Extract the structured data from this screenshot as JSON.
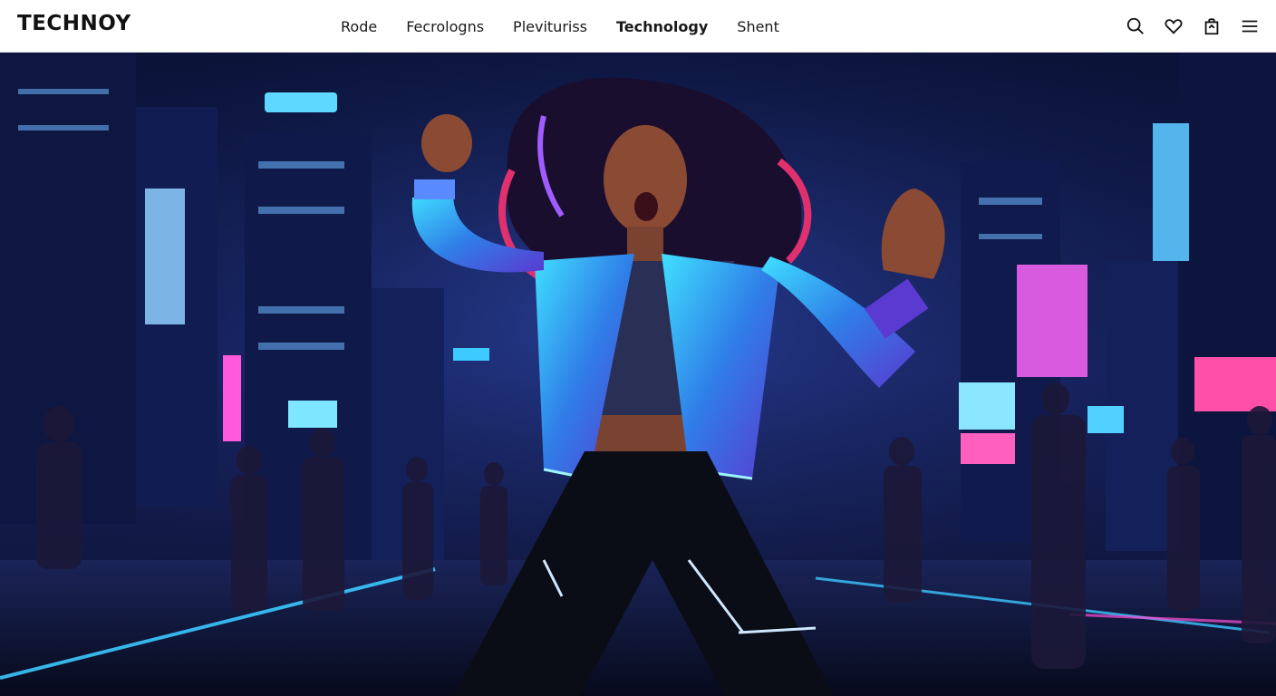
{
  "brand": {
    "name": "TECHNOY"
  },
  "nav": {
    "items": [
      {
        "label": "Rode",
        "active": false
      },
      {
        "label": "Fecrologns",
        "active": false
      },
      {
        "label": "Plevituriss",
        "active": false
      },
      {
        "label": "Technology",
        "active": true
      },
      {
        "label": "Shent",
        "active": false
      }
    ]
  },
  "actions": {
    "icons": [
      "search-icon",
      "heart-icon",
      "bag-icon",
      "menu-icon"
    ]
  },
  "hero": {
    "scene": "neon-city-dancer",
    "colors": {
      "sky": "#0c1440",
      "neon_blue": "#3cc8ff",
      "neon_pink": "#ff4fd8",
      "jacket": "#2aa8e8",
      "hair_accent": "#e0306e"
    }
  }
}
